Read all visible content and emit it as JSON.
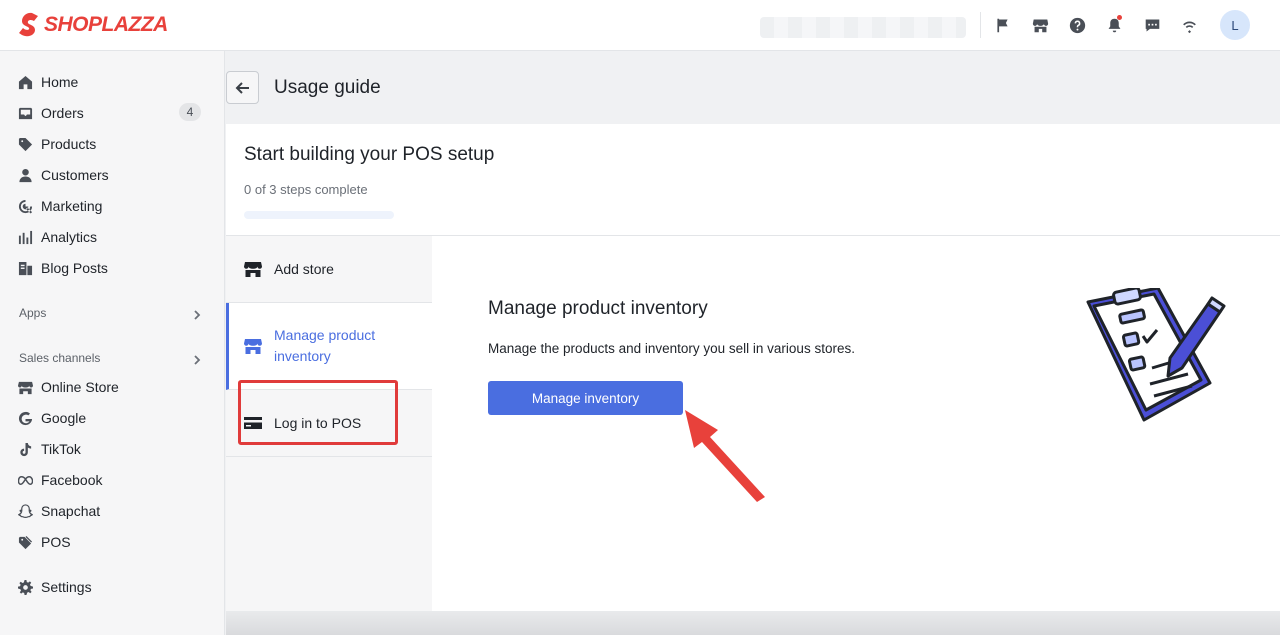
{
  "brand": {
    "name": "SHOPLAZZA"
  },
  "topbar": {
    "icons": [
      "flag-icon",
      "store-icon",
      "help-icon",
      "bell-icon",
      "chat-icon",
      "wifi-icon"
    ],
    "avatar_initial": "L"
  },
  "sidebar": {
    "items": [
      {
        "label": "Home",
        "icon": "home-icon"
      },
      {
        "label": "Orders",
        "icon": "inbox-icon",
        "badge": "4"
      },
      {
        "label": "Products",
        "icon": "tag-icon"
      },
      {
        "label": "Customers",
        "icon": "person-icon"
      },
      {
        "label": "Marketing",
        "icon": "marketing-icon"
      },
      {
        "label": "Analytics",
        "icon": "analytics-icon"
      },
      {
        "label": "Blog Posts",
        "icon": "blog-icon"
      }
    ],
    "apps_label": "Apps",
    "sales_channels_label": "Sales channels",
    "channels": [
      {
        "label": "Online Store",
        "icon": "store-icon"
      },
      {
        "label": "Google",
        "icon": "google-icon"
      },
      {
        "label": "TikTok",
        "icon": "tiktok-icon"
      },
      {
        "label": "Facebook",
        "icon": "meta-icon"
      },
      {
        "label": "Snapchat",
        "icon": "snapchat-icon"
      },
      {
        "label": "POS",
        "icon": "pos-tag-icon"
      }
    ],
    "settings_label": "Settings"
  },
  "page": {
    "title": "Usage guide",
    "card_title": "Start building your POS setup",
    "steps_complete": "0 of 3 steps complete",
    "progress": 0,
    "steps": [
      {
        "label": "Add store",
        "icon": "store-icon"
      },
      {
        "label_line1": "Manage product",
        "label_line2": "inventory",
        "icon": "store-icon"
      },
      {
        "label": "Log in to POS",
        "icon": "card-icon"
      }
    ],
    "detail": {
      "title": "Manage product inventory",
      "description": "Manage the products and inventory you sell in various stores.",
      "button": "Manage inventory"
    }
  },
  "colors": {
    "accent": "#4a6ee0",
    "brand": "#e8413b",
    "annotation": "#e03b3b"
  }
}
